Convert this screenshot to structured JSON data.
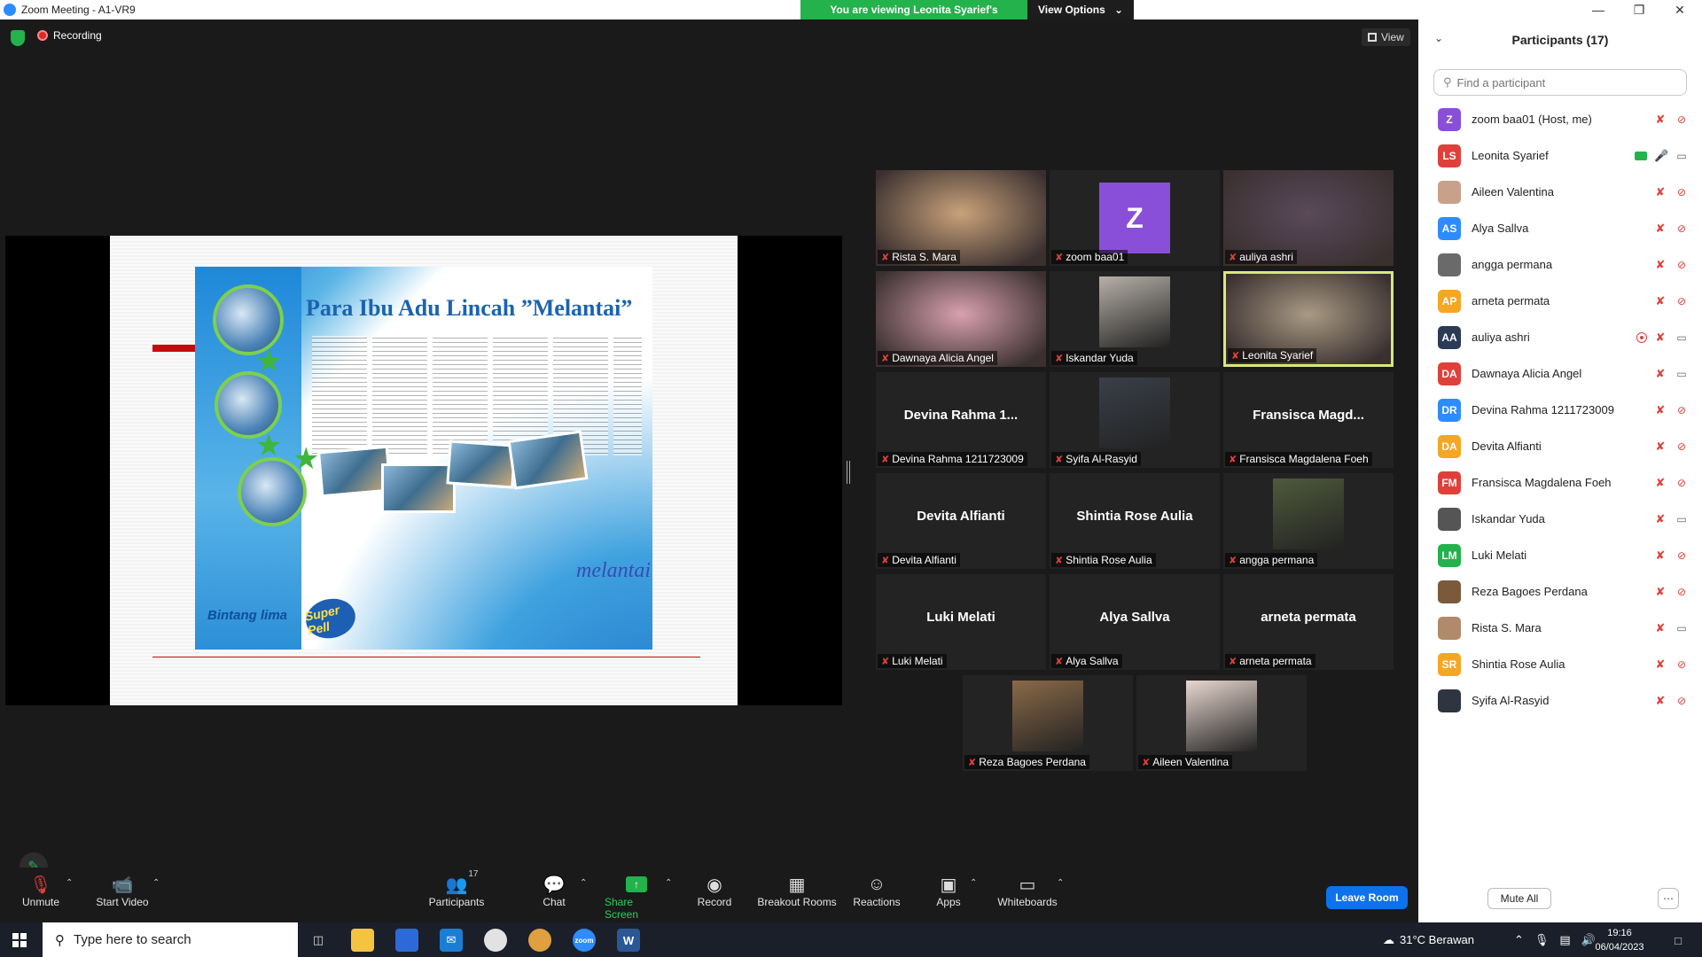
{
  "window": {
    "title": "Zoom Meeting - A1-VR9",
    "viewing_message": "You are viewing Leonita Syarief's screen",
    "view_options": "View Options"
  },
  "meeting": {
    "recording_label": "Recording",
    "view_label": "View"
  },
  "shared_slide": {
    "headline": "Para Ibu Adu Lincah ”Melantai”",
    "brand_left": "Bintang lima",
    "brand_super": "Super Pell",
    "brand_melantai": "melantai"
  },
  "tiles": [
    {
      "name": "Rista S. Mara",
      "type": "photo",
      "color": "#c9a27a"
    },
    {
      "name": "zoom baa01",
      "type": "avatar",
      "initial": "Z",
      "color": "#8a4fd8"
    },
    {
      "name": "auliya ashri",
      "type": "photo",
      "color": "#5a4a5a"
    },
    {
      "name": "Dawnaya Alicia Angel",
      "type": "photo",
      "color": "#d8a0b0"
    },
    {
      "name": "Iskandar Yuda",
      "type": "photo-center",
      "color": "#b6b0a8"
    },
    {
      "name": "Leonita Syarief",
      "type": "photo",
      "color": "#a89a84",
      "active": true
    },
    {
      "name": "Devina Rahma 1211723009",
      "type": "text",
      "center": "Devina Rahma 1..."
    },
    {
      "name": "Syifa Al-Rasyid",
      "type": "photo-center",
      "color": "#3a4048"
    },
    {
      "name": "Fransisca Magdalena Foeh",
      "type": "text",
      "center": "Fransisca  Magd..."
    },
    {
      "name": "Devita Alfianti",
      "type": "text",
      "center": "Devita Alfianti"
    },
    {
      "name": "Shintia Rose Aulia",
      "type": "text",
      "center": "Shintia Rose Aulia"
    },
    {
      "name": "angga permana",
      "type": "photo-center",
      "color": "#4f5a3c"
    },
    {
      "name": "Luki Melati",
      "type": "text",
      "center": "Luki Melati"
    },
    {
      "name": "Alya Sallva",
      "type": "text",
      "center": "Alya Sallva"
    },
    {
      "name": "arneta permata",
      "type": "text",
      "center": "arneta permata"
    },
    {
      "name": "Reza Bagoes Perdana",
      "type": "photo-center",
      "color": "#8a6a48"
    },
    {
      "name": "Aileen Valentina",
      "type": "photo-center",
      "color": "#e8d8d0"
    }
  ],
  "toolbar": {
    "unmute": "Unmute",
    "start_video": "Start Video",
    "participants": "Participants",
    "participants_count": "17",
    "chat": "Chat",
    "share_screen": "Share Screen",
    "record": "Record",
    "breakout_rooms": "Breakout Rooms",
    "reactions": "Reactions",
    "apps": "Apps",
    "whiteboards": "Whiteboards",
    "leave_room": "Leave Room"
  },
  "panel": {
    "title": "Participants (17)",
    "search_placeholder": "Find a participant",
    "mute_all": "Mute All",
    "participants": [
      {
        "name": "zoom baa01 (Host, me)",
        "initials": "Z",
        "color": "#8a4fd8",
        "mic": "off",
        "cam": "off"
      },
      {
        "name": "Leonita Syarief",
        "initials": "LS",
        "color": "#e0403a",
        "mic": "on",
        "cam": "on",
        "sharing": true
      },
      {
        "name": "Aileen Valentina",
        "initials": "",
        "color": "#c9a08a",
        "mic": "off",
        "cam": "off"
      },
      {
        "name": "Alya Sallva",
        "initials": "AS",
        "color": "#2d8cff",
        "mic": "off",
        "cam": "off"
      },
      {
        "name": "angga permana",
        "initials": "",
        "color": "#6a6a6a",
        "mic": "off",
        "cam": "off"
      },
      {
        "name": "arneta permata",
        "initials": "AP",
        "color": "#f5a623",
        "mic": "off",
        "cam": "off"
      },
      {
        "name": "auliya ashri",
        "initials": "AA",
        "color": "#2b3a55",
        "mic": "off",
        "cam": "on",
        "recording": true
      },
      {
        "name": "Dawnaya Alicia Angel",
        "initials": "DA",
        "color": "#e0403a",
        "mic": "off",
        "cam": "on"
      },
      {
        "name": "Devina Rahma 1211723009",
        "initials": "DR",
        "color": "#2d8cff",
        "mic": "off",
        "cam": "off"
      },
      {
        "name": "Devita Alfianti",
        "initials": "DA",
        "color": "#f5a623",
        "mic": "off",
        "cam": "off"
      },
      {
        "name": "Fransisca Magdalena Foeh",
        "initials": "FM",
        "color": "#e0403a",
        "mic": "off",
        "cam": "off"
      },
      {
        "name": "Iskandar Yuda",
        "initials": "",
        "color": "#555555",
        "mic": "off",
        "cam": "on"
      },
      {
        "name": "Luki Melati",
        "initials": "LM",
        "color": "#23b24b",
        "mic": "off",
        "cam": "off"
      },
      {
        "name": "Reza Bagoes Perdana",
        "initials": "",
        "color": "#7a5a3a",
        "mic": "off",
        "cam": "off"
      },
      {
        "name": "Rista S. Mara",
        "initials": "",
        "color": "#b08a6a",
        "mic": "off",
        "cam": "on"
      },
      {
        "name": "Shintia Rose Aulia",
        "initials": "SR",
        "color": "#f5a623",
        "mic": "off",
        "cam": "off"
      },
      {
        "name": "Syifa Al-Rasyid",
        "initials": "",
        "color": "#2e3440",
        "mic": "off",
        "cam": "off"
      }
    ]
  },
  "taskbar": {
    "search_placeholder": "Type here to search",
    "weather": "31°C  Berawan",
    "time": "19:16",
    "date": "06/04/2023"
  }
}
